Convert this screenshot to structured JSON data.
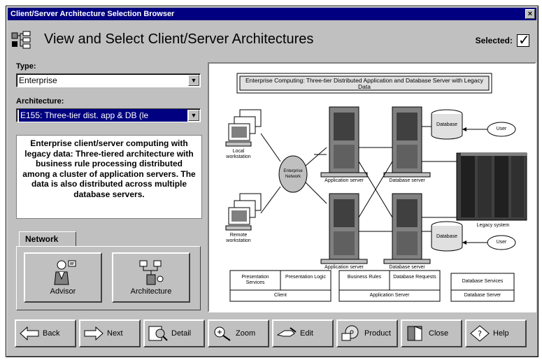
{
  "window": {
    "title": "Client/Server Architecture Selection Browser",
    "close_label": "×"
  },
  "header": {
    "title": "View and Select Client/Server Architectures",
    "selected_label": "Selected:"
  },
  "type_field": {
    "label": "Type:",
    "value": "Enterprise"
  },
  "architecture_field": {
    "label": "Architecture:",
    "value": "E155: Three-tier dist. app & DB (le"
  },
  "description": "Enterprise client/server computing with legacy data: Three-tiered architecture with business rule processing distributed among a cluster of application servers. The data is also distributed across multiple database servers.",
  "tabs": {
    "network_label": "Network",
    "advisor_label": "Advisor",
    "architecture_label": "Architecture"
  },
  "diagram": {
    "title": "Enterprise Computing: Three-tier Distributed Application and Database Server with Legacy Data",
    "local_workstation": "Local workstation",
    "remote_workstation": "Remote workstation",
    "network_cloud": "Enterprise Network",
    "app_server_top": "Application server",
    "app_server_bottom": "Application server",
    "db_server_top": "Database server",
    "db_server_bottom": "Database server",
    "database_top": "Database",
    "database_bottom": "Database",
    "user_top": "User",
    "user_bottom": "User",
    "legacy": "Legacy system",
    "table_client": {
      "cells": [
        "Presentation Services",
        "Presentation Logic"
      ],
      "footer": "Client"
    },
    "table_app": {
      "cells": [
        "Business Rules",
        "Database Requests"
      ],
      "footer": "Application Server"
    },
    "table_db": {
      "cells": [
        "Database Services"
      ],
      "footer": "Database Server"
    }
  },
  "toolbar": {
    "back": "Back",
    "next": "Next",
    "detail": "Detail",
    "zoom": "Zoom",
    "edit": "Edit",
    "product": "Product",
    "close": "Close",
    "help": "Help"
  },
  "colors": {
    "titlebar": "#000080",
    "face": "#c0c0c0",
    "highlight": "#000080"
  }
}
